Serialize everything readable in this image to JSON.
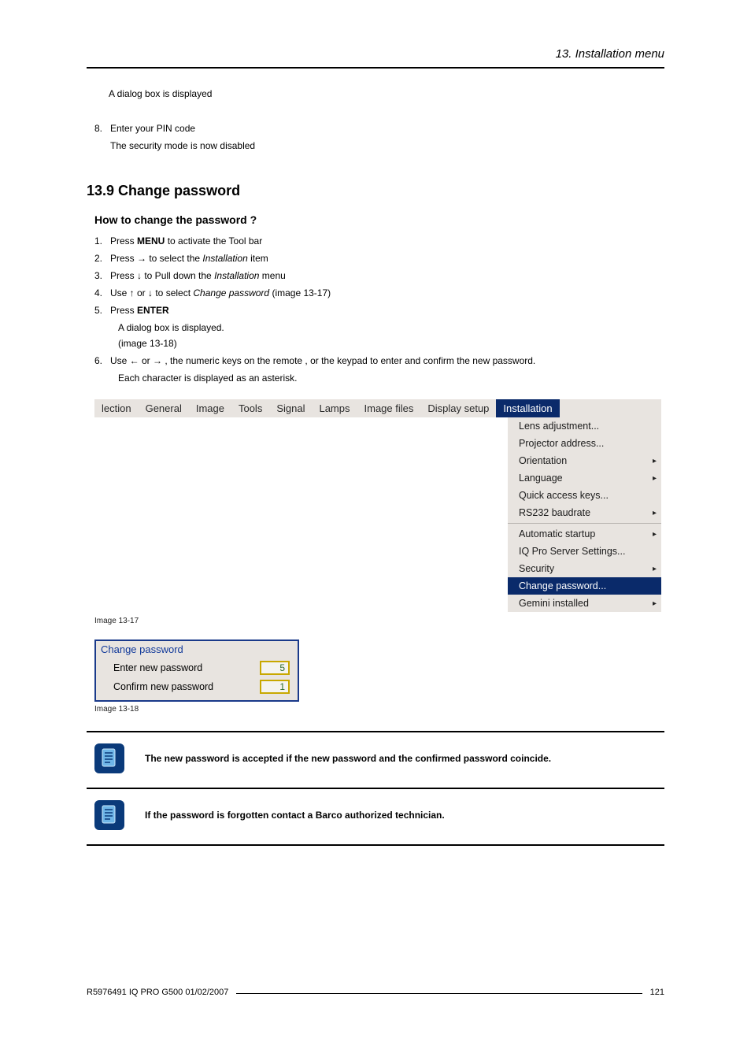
{
  "header": {
    "title": "13.  Installation menu"
  },
  "intro": {
    "dialog_line": "A dialog box is displayed",
    "step8_num": "8.",
    "step8_text": "Enter your PIN code",
    "step8_sub": "The security mode is now disabled"
  },
  "section": {
    "heading": "13.9  Change password",
    "subheading": "How to change the password ?"
  },
  "steps": {
    "s1_num": "1.",
    "s1_a": "Press ",
    "s1_b": "MENU",
    "s1_c": " to activate the Tool bar",
    "s2_num": "2.",
    "s2_a": "Press → to select the ",
    "s2_b": "Installation",
    "s2_c": " item",
    "s3_num": "3.",
    "s3_a": "Press ↓ to Pull down the ",
    "s3_b": "Installation",
    "s3_c": " menu",
    "s4_num": "4.",
    "s4_a": "Use ↑ or ↓ to select ",
    "s4_b": "Change password",
    "s4_c": " (image 13-17)",
    "s5_num": "5.",
    "s5_a": "Press ",
    "s5_b": "ENTER",
    "s5_sub1": "A dialog box is displayed.",
    "s5_sub2": "(image 13-18)",
    "s6_num": "6.",
    "s6_a": "Use ← or → , the numeric keys on the remote , or the keypad to enter and confirm the new password.",
    "s6_sub": "Each character is displayed as an asterisk."
  },
  "menubar": {
    "tabs": [
      "lection",
      "General",
      "Image",
      "Tools",
      "Signal",
      "Lamps",
      "Image files",
      "Display setup",
      "Installation"
    ],
    "active_index": 8
  },
  "dropdown": {
    "items": [
      {
        "label": "Lens adjustment...",
        "arrow": false
      },
      {
        "label": "Projector address...",
        "arrow": false
      },
      {
        "label": "Orientation",
        "arrow": true
      },
      {
        "label": "Language",
        "arrow": true
      },
      {
        "label": "Quick access keys...",
        "arrow": false
      },
      {
        "label": "RS232 baudrate",
        "arrow": true
      }
    ],
    "items2": [
      {
        "label": "Automatic startup",
        "arrow": true
      },
      {
        "label": "IQ Pro Server Settings...",
        "arrow": false
      },
      {
        "label": "Security",
        "arrow": true
      },
      {
        "label": "Change password...",
        "arrow": false,
        "selected": true
      },
      {
        "label": "Gemini installed",
        "arrow": true
      }
    ]
  },
  "captions": {
    "img1": "Image 13-17",
    "img2": "Image 13-18"
  },
  "dialog": {
    "title": "Change password",
    "row1_label": "Enter new password",
    "row1_val": "5",
    "row2_label": "Confirm new password",
    "row2_val": "1"
  },
  "notes": {
    "n1": "The new password is accepted if the new password and the confirmed password coincide.",
    "n2": "If the password is forgotten contact a Barco authorized technician."
  },
  "footer": {
    "docid": "R5976491  IQ PRO G500  01/02/2007",
    "page": "121"
  }
}
